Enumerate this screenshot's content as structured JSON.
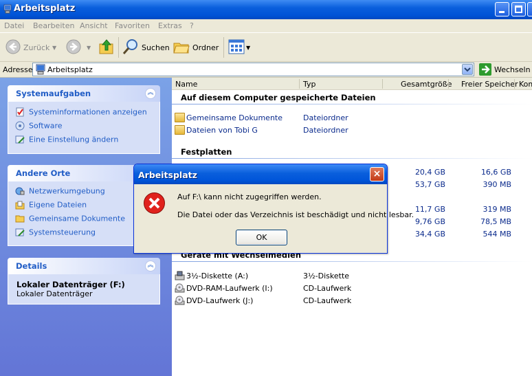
{
  "window": {
    "title": "Arbeitsplatz"
  },
  "menu": [
    "Datei",
    "Bearbeiten",
    "Ansicht",
    "Favoriten",
    "Extras",
    "?"
  ],
  "toolbar": {
    "back": "Zurück",
    "search": "Suchen",
    "folders": "Ordner"
  },
  "address": {
    "label": "Adresse",
    "value": "Arbeitsplatz",
    "go": "Wechseln z"
  },
  "sidebar": {
    "system_tasks": {
      "title": "Systemaufgaben",
      "items": [
        "Systeminformationen anzeigen",
        "Software",
        "Eine Einstellung ändern"
      ]
    },
    "other_places": {
      "title": "Andere Orte",
      "items": [
        "Netzwerkumgebung",
        "Eigene Dateien",
        "Gemeinsame Dokumente",
        "Systemsteuerung"
      ]
    },
    "details": {
      "title": "Details",
      "name": "Lokaler Datenträger (F:)",
      "type": "Lokaler Datenträger"
    }
  },
  "columns": {
    "name": "Name",
    "type": "Typ",
    "total": "Gesamtgröße",
    "free": "Freier Speicher",
    "comment": "Kom"
  },
  "groups": {
    "stored_files": "Auf diesem Computer gespeicherte Dateien",
    "hard_disks": "Festplatten",
    "removable": "Geräte mit Wechselmedien"
  },
  "stored_files": [
    {
      "name": "Gemeinsame Dokumente",
      "type": "Dateiordner"
    },
    {
      "name": "Dateien von Tobi G",
      "type": "Dateiordner"
    }
  ],
  "disks": [
    {
      "total": "20,4 GB",
      "free": "16,6 GB"
    },
    {
      "total": "53,7 GB",
      "free": "390 MB"
    },
    {
      "total": "11,7 GB",
      "free": "319 MB"
    },
    {
      "total": "9,76 GB",
      "free": "78,5 MB"
    },
    {
      "total": "34,4 GB",
      "free": "544 MB"
    }
  ],
  "removable": [
    {
      "name": "3½-Diskette (A:)",
      "type": "3½-Diskette"
    },
    {
      "name": "DVD-RAM-Laufwerk (I:)",
      "type": "CD-Laufwerk"
    },
    {
      "name": "DVD-Laufwerk (J:)",
      "type": "CD-Laufwerk"
    }
  ],
  "dialog": {
    "title": "Arbeitsplatz",
    "line1": "Auf F:\\ kann nicht zugegriffen werden.",
    "line2": "Die Datei oder das Verzeichnis ist beschädigt und nicht lesbar.",
    "ok": "OK",
    "close": "×"
  }
}
